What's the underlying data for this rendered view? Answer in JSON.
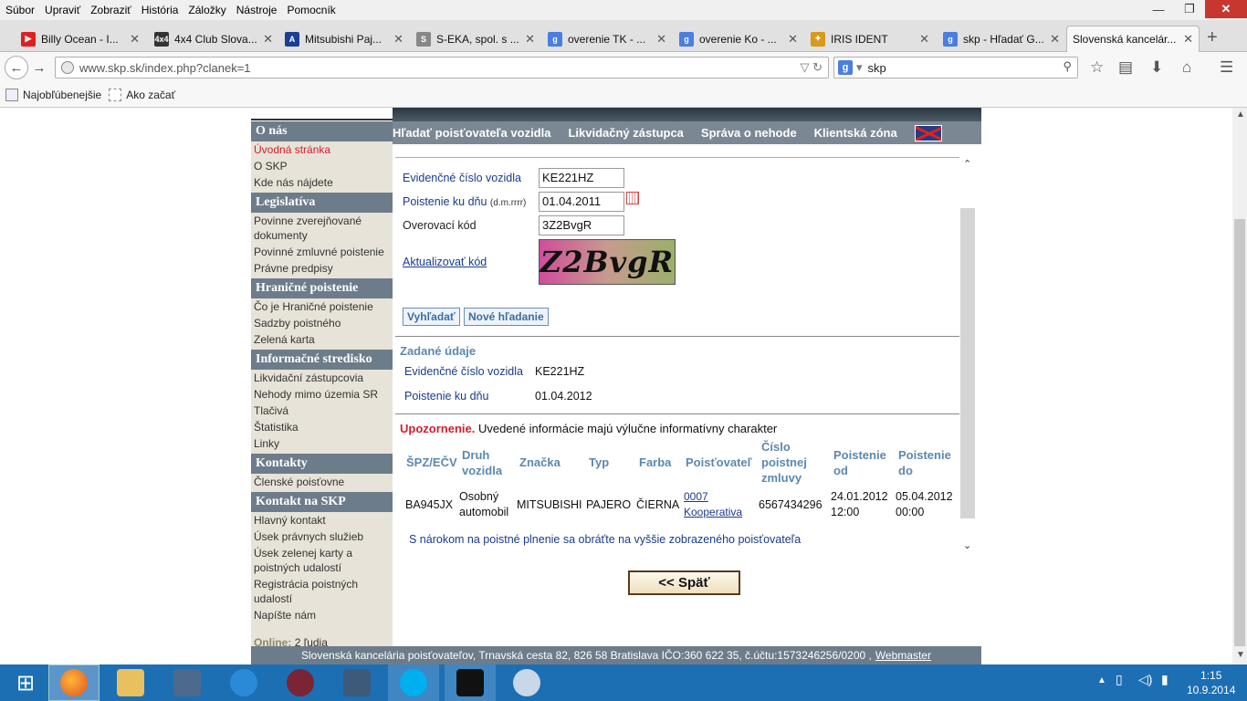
{
  "menu": [
    "Súbor",
    "Upraviť",
    "Zobraziť",
    "História",
    "Záložky",
    "Nástroje",
    "Pomocník"
  ],
  "window_controls": {
    "minimize": "—",
    "maximize": "❐",
    "close": "✕"
  },
  "tabs": [
    {
      "title": "Billy Ocean - I...",
      "fav": "▶",
      "color": "#e02020"
    },
    {
      "title": "4x4 Club Slova...",
      "fav": "4x4",
      "color": "#333"
    },
    {
      "title": "Mitsubishi Paj...",
      "fav": "A",
      "color": "#1c3f94"
    },
    {
      "title": "S-EKA, spol. s ...",
      "fav": "S",
      "color": "#888"
    },
    {
      "title": "overenie TK - ...",
      "fav": "g",
      "color": "#4a7fe0"
    },
    {
      "title": "overenie Ko - ...",
      "fav": "g",
      "color": "#4a7fe0"
    },
    {
      "title": "IRIS IDENT",
      "fav": "✦",
      "color": "#d79a1b"
    },
    {
      "title": "skp - Hľadať G...",
      "fav": "g",
      "color": "#4a7fe0"
    },
    {
      "title": "Slovenská kancelár...",
      "fav": "",
      "color": "#f7f7f7"
    }
  ],
  "url": "www.skp.sk/index.php?clanek=1",
  "search_value": "skp",
  "bookmarks": [
    "Najobľúbenejšie",
    "Ako začať"
  ],
  "sidebar": [
    {
      "head": "O nás",
      "items": [
        "Úvodná stránka",
        "O SKP",
        "Kde nás nájdete"
      ]
    },
    {
      "head": "Legislatíva",
      "items": [
        "Povinne zverejňované dokumenty",
        "Povinné zmluvné poistenie",
        "Právne predpisy"
      ]
    },
    {
      "head": "Hraničné poistenie",
      "items": [
        "Čo je Hraničné poistenie",
        "Sadzby poistného",
        "Zelená karta"
      ]
    },
    {
      "head": "Informačné stredisko",
      "items": [
        "Likvidační zástupcovia",
        "Nehody mimo územia SR",
        "Tlačivá",
        "Štatistika",
        "Linky"
      ]
    },
    {
      "head": "Kontakty",
      "items": [
        "Členské poisťovne"
      ]
    },
    {
      "head": "Kontakt na SKP",
      "items": [
        "Hlavný kontakt",
        "Úsek právnych služieb",
        "Úsek zelenej karty a poistných udalostí",
        "Registrácia poistných udalostí",
        "Napíšte nám"
      ]
    }
  ],
  "online_label": "Online:",
  "online_value": "2 ľudia",
  "nav": [
    "Hľadať poisťovateľa vozidla",
    "Likvidačný zástupca",
    "Správa o nehode",
    "Klientská zóna"
  ],
  "form": {
    "ecv_label": "Evidenčné číslo vozidla",
    "ecv_value": "KE221HZ",
    "date_label": "Poistenie ku dňu",
    "date_hint": "(d.m.rrrr)",
    "date_value": "01.04.2011",
    "code_label": "Overovací kód",
    "code_value": "3Z2BvgR",
    "refresh_label": "Aktualizovať kód",
    "captcha_text": "Z2BvgR",
    "search_btn": "Vyhľadať",
    "new_btn": "Nové hľadanie"
  },
  "given": {
    "title": "Zadané údaje",
    "ecv_label": "Evidenčné číslo vozidla",
    "ecv_value": "KE221HZ",
    "date_label": "Poistenie ku dňu",
    "date_value": "01.04.2012"
  },
  "warning": {
    "bold": "Upozornenie.",
    "text": " Uvedené informácie majú výlučne informatívny charakter"
  },
  "table": {
    "headers": [
      "ŠPZ/EČV",
      "Druh vozidla",
      "Značka",
      "Typ",
      "Farba",
      "Poisťovateľ",
      "Číslo poistnej zmluvy",
      "Poistenie od",
      "Poistenie do"
    ],
    "row": [
      "BA945JX",
      "Osobný automobil",
      "MITSUBISHI",
      "PAJERO",
      "ČIERNA",
      "0007 Kooperativa",
      "6567434296",
      "24.01.2012 12:00",
      "05.04.2012 00:00"
    ]
  },
  "claim_note": "S nárokom na poistné plnenie sa obráťte na vyššie zobrazeného poisťovateľa",
  "back_btn": "<<  Späť",
  "footer": {
    "text": "Slovenská kancelária poisťovateľov, Trnavská cesta 82, 826 58 Bratislava IČO:360 622 35, č.účtu:1573246256/0200 ,",
    "link": "Webmaster"
  },
  "clock": {
    "time": "1:15",
    "date": "10.9.2014"
  }
}
